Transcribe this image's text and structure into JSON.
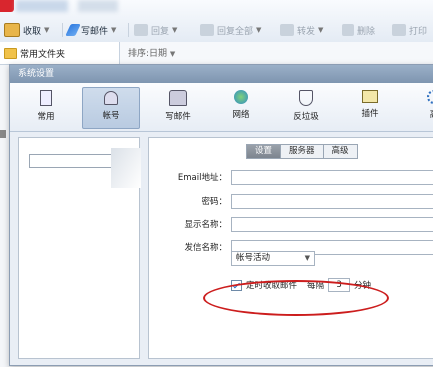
{
  "toolbar": {
    "receive": "收取",
    "compose": "写邮件",
    "reply": "回复",
    "reply_all": "回复全部",
    "forward": "转发",
    "delete": "删除",
    "print": "打印"
  },
  "folder": {
    "label": "常用文件夹"
  },
  "list": {
    "sort_label": "排序:日期"
  },
  "dialog": {
    "title": "系统设置",
    "tabs": [
      {
        "label": "常用",
        "icon": "general-icon"
      },
      {
        "label": "帐号",
        "icon": "account-icon"
      },
      {
        "label": "写邮件",
        "icon": "compose-icon"
      },
      {
        "label": "网络",
        "icon": "network-icon"
      },
      {
        "label": "反垃圾",
        "icon": "antispam-icon"
      },
      {
        "label": "插件",
        "icon": "plugin-icon"
      },
      {
        "label": "高",
        "icon": "advanced-icon"
      }
    ],
    "active_tab": "帐号",
    "panel_tabs": [
      "设置",
      "服务器",
      "高级"
    ],
    "active_panel_tab": "设置",
    "fields": {
      "email_label": "Email地址：",
      "email_value": "",
      "password_label": "密码：",
      "display_name_label": "显示名称：",
      "sender_name_label": "发信名称："
    },
    "account_status": "帐号活动",
    "schedule": {
      "checkbox_label": "定时收取邮件",
      "every_label": "每隔",
      "minutes_value": "3",
      "unit_label": "分钟",
      "checked": true
    }
  },
  "colors": {
    "highlight": "#cc1d1d",
    "active_tab": "#b9cbe1"
  }
}
